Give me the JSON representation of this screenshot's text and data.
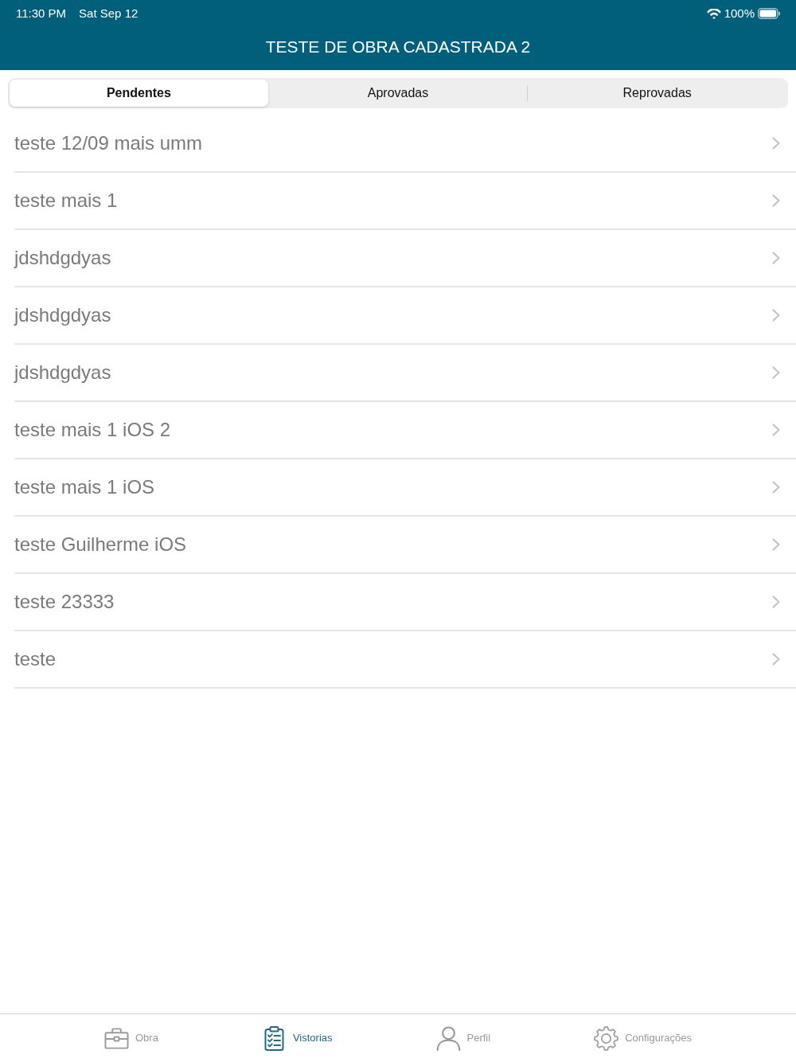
{
  "status_bar": {
    "time": "11:30 PM",
    "date": "Sat Sep 12",
    "battery": "100%"
  },
  "nav_bar": {
    "title": "TESTE DE OBRA CADASTRADA 2"
  },
  "segments": [
    {
      "label": "Pendentes",
      "selected": true
    },
    {
      "label": "Aprovadas",
      "selected": false
    },
    {
      "label": "Reprovadas",
      "selected": false
    }
  ],
  "list": {
    "items": [
      {
        "title": "teste 12/09 mais umm"
      },
      {
        "title": "teste mais 1"
      },
      {
        "title": "jdshdgdyas"
      },
      {
        "title": "jdshdgdyas"
      },
      {
        "title": "jdshdgdyas"
      },
      {
        "title": "teste mais 1 iOS 2"
      },
      {
        "title": "teste mais 1 iOS"
      },
      {
        "title": "teste Guilherme iOS"
      },
      {
        "title": "teste 23333"
      },
      {
        "title": "teste"
      }
    ]
  },
  "tab_bar": {
    "items": [
      {
        "label": "Obra",
        "kind": "briefcase",
        "selected": false
      },
      {
        "label": "Vistorias",
        "kind": "clipboard",
        "selected": true
      },
      {
        "label": "Perfil",
        "kind": "person",
        "selected": false
      },
      {
        "label": "Configurações",
        "kind": "gear",
        "selected": false
      }
    ]
  }
}
